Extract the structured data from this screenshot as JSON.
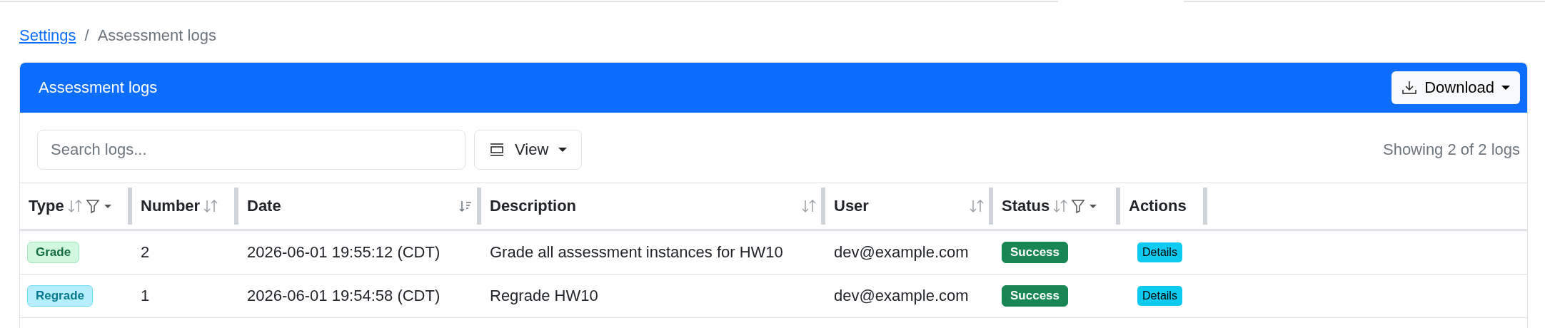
{
  "breadcrumb": [
    {
      "label": "Settings",
      "kind": "link"
    },
    {
      "label": "/",
      "kind": "separator"
    },
    {
      "label": "Assessment logs",
      "kind": "current"
    }
  ],
  "card": {
    "title": "Assessment logs",
    "download": "Download"
  },
  "toolbar": {
    "search": {
      "placeholder": "Search logs..."
    },
    "view": "View",
    "summary": "Showing 2 of 2 logs"
  },
  "table": {
    "columns": [
      {
        "label": "Type",
        "sortable": true,
        "sorted": false,
        "filter": true
      },
      {
        "label": "Number",
        "sortable": true,
        "sorted": false,
        "filter": false
      },
      {
        "label": "Date",
        "sortable": true,
        "sorted": true,
        "filter": false
      },
      {
        "label": "Description",
        "sortable": true,
        "sorted": false,
        "filter": false
      },
      {
        "label": "User",
        "sortable": true,
        "sorted": false,
        "filter": false
      },
      {
        "label": "Status",
        "sortable": true,
        "sorted": false,
        "filter": true
      },
      {
        "label": "Actions",
        "sortable": false,
        "filter": false
      }
    ],
    "rows": [
      {
        "type": {
          "label": "Grade",
          "kind": "grade"
        },
        "number": "2",
        "date": "2026-06-01 19:55:12 (CDT)",
        "description": "Grade all assessment instances for HW10",
        "user": "dev@example.com",
        "status": {
          "label": "Success",
          "kind": "success"
        },
        "action": "Details"
      },
      {
        "type": {
          "label": "Regrade",
          "kind": "regrade"
        },
        "number": "1",
        "date": "2026-06-01 19:54:58 (CDT)",
        "description": "Regrade HW10",
        "user": "dev@example.com",
        "status": {
          "label": "Success",
          "kind": "success"
        },
        "action": "Details"
      }
    ]
  }
}
